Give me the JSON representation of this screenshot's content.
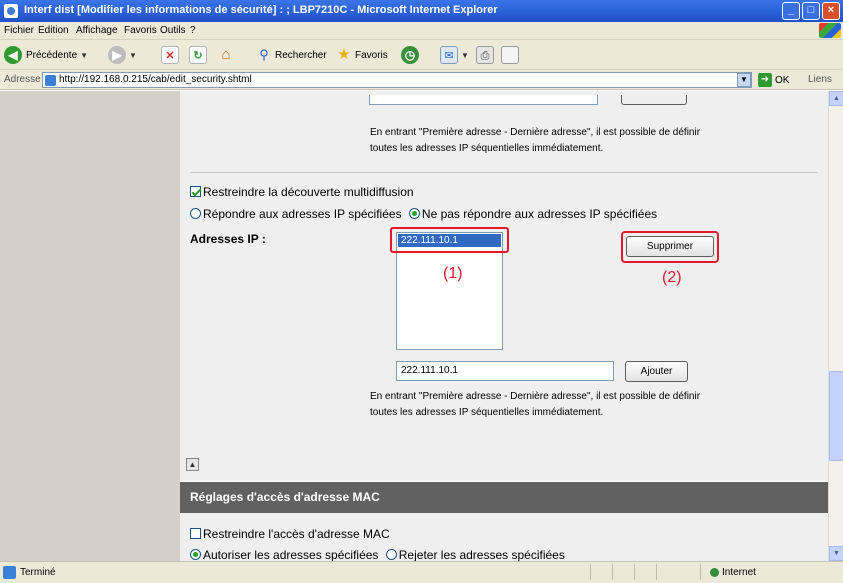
{
  "window": {
    "title": "Interf dist [Modifier les informations de sécurité] : ; LBP7210C - Microsoft Internet Explorer",
    "minimize": "_",
    "maximize": "□",
    "close": "×"
  },
  "menubar": {
    "items": [
      "Fichier",
      "Edition",
      "Affichage",
      "Favoris",
      "Outils",
      "?"
    ]
  },
  "toolbar": {
    "back_label": "Précédente",
    "search_label": "Rechercher",
    "favorites_label": "Favoris"
  },
  "address": {
    "label": "Adresse",
    "url": "http://192.168.0.215/cab/edit_security.shtml",
    "go_label": "OK",
    "links_label": "Liens"
  },
  "page": {
    "hint_line1": "En entrant \"Première adresse - Dernière adresse\", il est possible de définir",
    "hint_line2": "toutes les adresses IP séquentielles immédiatement.",
    "multicast_checkbox_label": "Restreindre la découverte multidiffusion",
    "multicast_checked": true,
    "radio_respond_label": "Répondre aux adresses IP spécifiées",
    "radio_no_respond_label": "Ne pas répondre aux adresses IP spécifiées",
    "radio_selected": "no_respond",
    "ip_label": "Adresses IP :",
    "ip_list": [
      "222.111.10.1"
    ],
    "ip_list_selected": "222.111.10.1",
    "delete_button": "Supprimer",
    "callout_1": "(1)",
    "callout_2": "(2)",
    "ip_input_value": "222.111.10.1",
    "add_button": "Ajouter",
    "top_icon": "▲",
    "mac_section_title": "Réglages d'accès d'adresse MAC",
    "mac_checkbox_label": "Restreindre l'accès d'adresse MAC",
    "mac_checked": false,
    "mac_radio_allow_label": "Autoriser les adresses spécifiées",
    "mac_radio_reject_label": "Rejeter les adresses spécifiées",
    "mac_radio_selected": "allow"
  },
  "status": {
    "text": "Terminé",
    "zone": "Internet"
  },
  "colors": {
    "highlight_red": "#e01a2a",
    "section_header": "#616161",
    "selection_blue": "#316ac5"
  }
}
